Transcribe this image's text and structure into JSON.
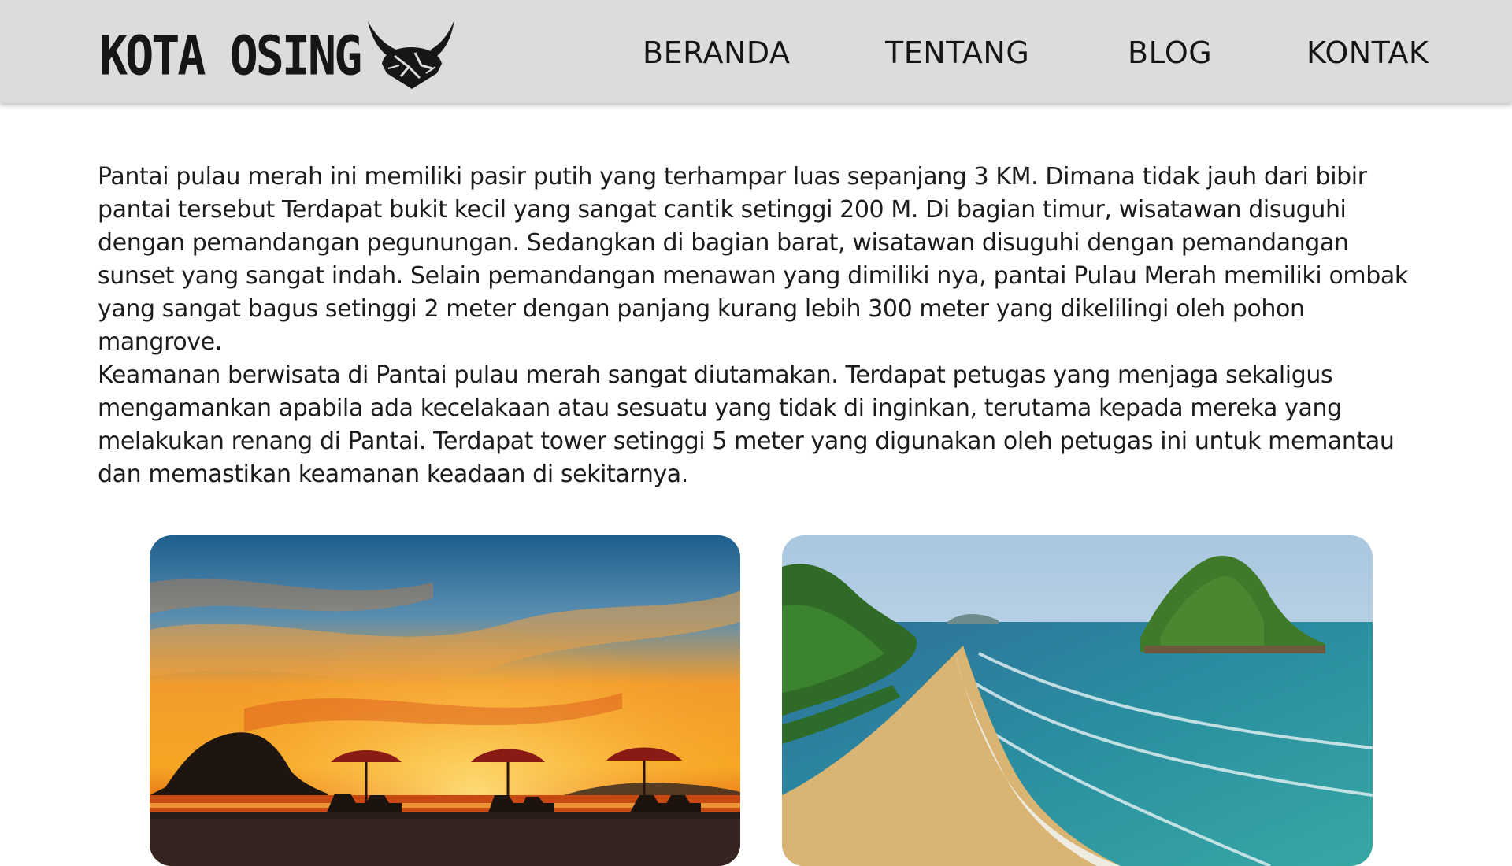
{
  "header": {
    "brand": {
      "text": "KOTA OSING",
      "icon": "horned-helmet-logo-icon"
    },
    "nav": [
      {
        "label": "BERANDA"
      },
      {
        "label": "TENTANG"
      },
      {
        "label": "BLOG"
      },
      {
        "label": "KONTAK"
      }
    ]
  },
  "article": {
    "paragraphs": [
      "Pantai pulau merah ini memiliki pasir putih yang terhampar luas sepanjang 3 KM. Dimana tidak jauh dari bibir pantai tersebut Terdapat bukit kecil yang sangat cantik setinggi 200 M. Di bagian timur, wisatawan disuguhi dengan pemandangan pegunungan. Sedangkan di bagian barat, wisatawan disuguhi dengan pemandangan sunset yang sangat indah. Selain pemandangan menawan yang dimiliki nya, pantai Pulau Merah memiliki ombak yang sangat bagus setinggi 2 meter dengan panjang kurang lebih 300 meter yang dikelilingi oleh pohon mangrove.",
      "Keamanan berwisata di Pantai pulau merah sangat diutamakan. Terdapat petugas yang menjaga sekaligus mengamankan apabila ada kecelakaan atau sesuatu yang tidak di inginkan, terutama kepada mereka yang melakukan renang di Pantai. Terdapat tower setinggi 5 meter yang digunakan oleh petugas ini untuk memantau dan memastikan keamanan keadaan di sekitarnya."
    ]
  },
  "gallery": {
    "images": [
      {
        "name": "sunset-beach-umbrellas-photo"
      },
      {
        "name": "aerial-beach-island-photo"
      }
    ]
  },
  "colors": {
    "navbar_bg": "#dcdcdc",
    "text": "#1c1c1c"
  }
}
